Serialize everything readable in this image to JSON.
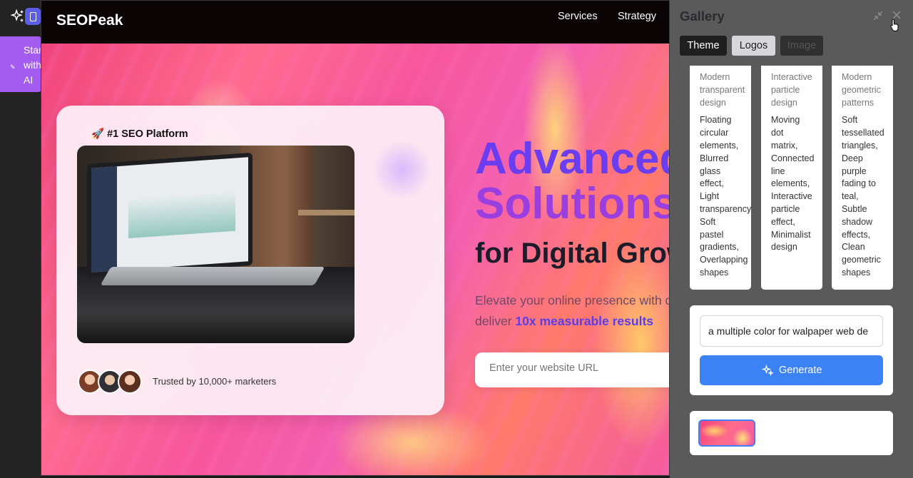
{
  "leftbar": {
    "start_label": "Start\nwith\nAI"
  },
  "site": {
    "brand": "SEOPeak",
    "nav": [
      "Services",
      "Strategy"
    ],
    "badge": "🚀 #1 SEO Platform",
    "trusted": "Trusted by 10,000+ marketers",
    "headline_1": "Advanced",
    "headline_2": "Solutions",
    "headline_3": "for Digital Growth",
    "sub_line_1": "Elevate your online presence with data-driven strategies that",
    "sub_line_2_prefix": "deliver ",
    "sub_line_2_highlight": "10x measurable results",
    "url_placeholder": "Enter your website URL",
    "accent": "#6a3df0"
  },
  "gallery": {
    "title": "Gallery",
    "tabs": [
      "Theme",
      "Logos",
      "Image"
    ],
    "active_tab": "Theme",
    "styles": [
      {
        "description": "Modern\ntransparent\ndesign",
        "features": "Floating\ncircular\nelements,\nBlurred\nglass\neffect,\nLight\ntransparency,\nSoft\npastel\ngradients,\nOverlapping\nshapes"
      },
      {
        "description": "Interactive\nparticle\ndesign",
        "features": "Moving\ndot\nmatrix,\nConnected\nline\nelements,\nInteractive\nparticle\neffect,\nMinimalist\ndesign"
      },
      {
        "description": "Modern\ngeometric\npatterns",
        "features": "Soft\ntessellated\ntriangles,\nDeep\npurple\nfading to\nteal,\nSubtle\nshadow\neffects,\nClean\ngeometric\nshapes"
      }
    ],
    "prompt_value": "a multiple color for walpaper web de",
    "generate_label": "Generate",
    "accent": "#3b82f6"
  }
}
